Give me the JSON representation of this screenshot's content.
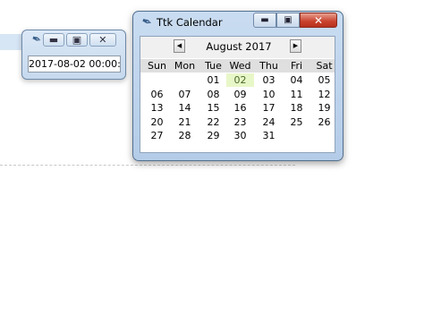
{
  "mini_window": {
    "value": "2017-08-02 00:00:00",
    "minimize": "▬",
    "maximize": "▣",
    "close": "✕"
  },
  "calendar_window": {
    "title": "Ttk Calendar",
    "minimize": "▬",
    "maximize": "▣",
    "close": "✕",
    "prev_button": "◀",
    "next_button": "▶",
    "month_label": "August 2017",
    "weekdays": [
      "Sun",
      "Mon",
      "Tue",
      "Wed",
      "Thu",
      "Fri",
      "Sat"
    ],
    "weeks": [
      [
        "",
        "",
        "01",
        "02",
        "03",
        "04",
        "05"
      ],
      [
        "06",
        "07",
        "08",
        "09",
        "10",
        "11",
        "12"
      ],
      [
        "13",
        "14",
        "15",
        "16",
        "17",
        "18",
        "19"
      ],
      [
        "20",
        "21",
        "22",
        "23",
        "24",
        "25",
        "26"
      ],
      [
        "27",
        "28",
        "29",
        "30",
        "31",
        "",
        ""
      ]
    ],
    "selected_day": "02",
    "selected_color": "#e8f7c8"
  }
}
